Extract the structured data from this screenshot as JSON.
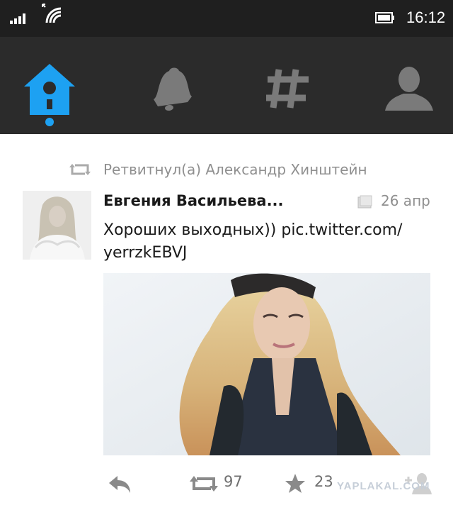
{
  "status_bar": {
    "time": "16:12",
    "icons": [
      "signal-icon",
      "wifi-icon",
      "battery-icon"
    ]
  },
  "nav": {
    "tabs": [
      {
        "name": "home",
        "icon": "birdhouse-icon",
        "active": true
      },
      {
        "name": "notifications",
        "icon": "bell-icon",
        "active": false
      },
      {
        "name": "discover",
        "icon": "hashtag-icon",
        "active": false
      },
      {
        "name": "profile",
        "icon": "person-icon",
        "active": false
      }
    ],
    "active_color": "#1da1f2",
    "inactive_color": "#7a7a7a"
  },
  "tweet": {
    "retweeted_by": "Ретвитнул(а) Александр Хинштейн",
    "author": "Евгения Васильева...",
    "date": "26 апр",
    "text": "Хороших выходных)) pic.twitter.com/ yerrzkEBVJ",
    "retweet_count": "97",
    "favorite_count": "23"
  },
  "watermark": "YAPLAKAL.COM"
}
